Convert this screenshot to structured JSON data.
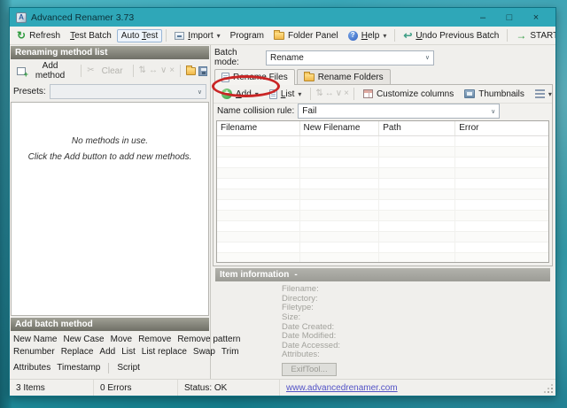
{
  "window": {
    "title": "Advanced Renamer 3.73",
    "app_icon_letter": "A",
    "controls": {
      "minimize": "–",
      "maximize": "□",
      "close": "×"
    }
  },
  "toolbar": {
    "refresh": "Refresh",
    "test_batch": {
      "pre": "",
      "key": "T",
      "post": "est Batch"
    },
    "auto_test": {
      "pre": "Auto ",
      "key": "T",
      "post": "est"
    },
    "import": {
      "pre": "",
      "key": "I",
      "post": "mport"
    },
    "program": "Program",
    "folder_panel": "Folder Panel",
    "help": {
      "pre": "",
      "key": "H",
      "post": "elp"
    },
    "undo": {
      "pre": "",
      "key": "U",
      "post": "ndo Previous Batch"
    },
    "start_batch": "START BATCH"
  },
  "left": {
    "panel_header": "Renaming method list",
    "add_method_label": "Add method",
    "clear_label": "Clear",
    "presets_label": "Presets:",
    "empty_state": {
      "line1": "No methods in use.",
      "line2": "Click the Add button to add new methods."
    },
    "add_batch_header": "Add batch method",
    "batch_rows": [
      [
        "New Name",
        "New Case",
        "Move",
        "Remove",
        "Remove pattern"
      ],
      [
        "Renumber",
        "Replace",
        "Add",
        "List",
        "List replace",
        "Swap",
        "Trim"
      ],
      [
        "Attributes",
        "Timestamp",
        "Script"
      ]
    ]
  },
  "right": {
    "batch_mode_label": "Batch mode:",
    "batch_mode_value": "Rename",
    "tabs": {
      "files": "Rename Files",
      "folders": "Rename Folders"
    },
    "toolbar": {
      "add": {
        "pre": "",
        "key": "A",
        "post": "dd"
      },
      "list": {
        "pre": "",
        "key": "L",
        "post": "ist"
      },
      "customize_columns": "Customize columns",
      "thumbnails": "Thumbnails"
    },
    "collision_label": "Name collision rule:",
    "collision_value": "Fail",
    "table": {
      "columns": [
        "Filename",
        "New Filename",
        "Path",
        "Error"
      ],
      "empty_row_count": 15
    },
    "item_info": {
      "header": "Item information",
      "collapse_indicator": "-",
      "fields": [
        "Filename:",
        "Directory:",
        "Filetype:",
        "Size:",
        "Date Created:",
        "Date Modified:",
        "Date Accessed:",
        "Attributes:"
      ],
      "exiftool_label": "ExifTool..."
    }
  },
  "statusbar": {
    "items": "3 Items",
    "errors": "0 Errors",
    "status": "Status: OK",
    "link": "www.advancedrenamer.com"
  },
  "icons": {
    "refresh": "↻",
    "undo": "↩",
    "start_arrow": "→",
    "dropdown_arrow": "▾",
    "chevron_down": "∨",
    "cut": "✂",
    "plus": "+",
    "question_mark": "?",
    "disabled_arrows": [
      "⇅",
      "↔",
      "∨",
      "×"
    ]
  },
  "colors": {
    "titlebar": "#2fa7b8",
    "annotation": "#c92525",
    "link": "#5353c6",
    "header_top": "#a0a095",
    "header_bottom": "#6f6f66",
    "info_header": "#b2b2ac"
  }
}
